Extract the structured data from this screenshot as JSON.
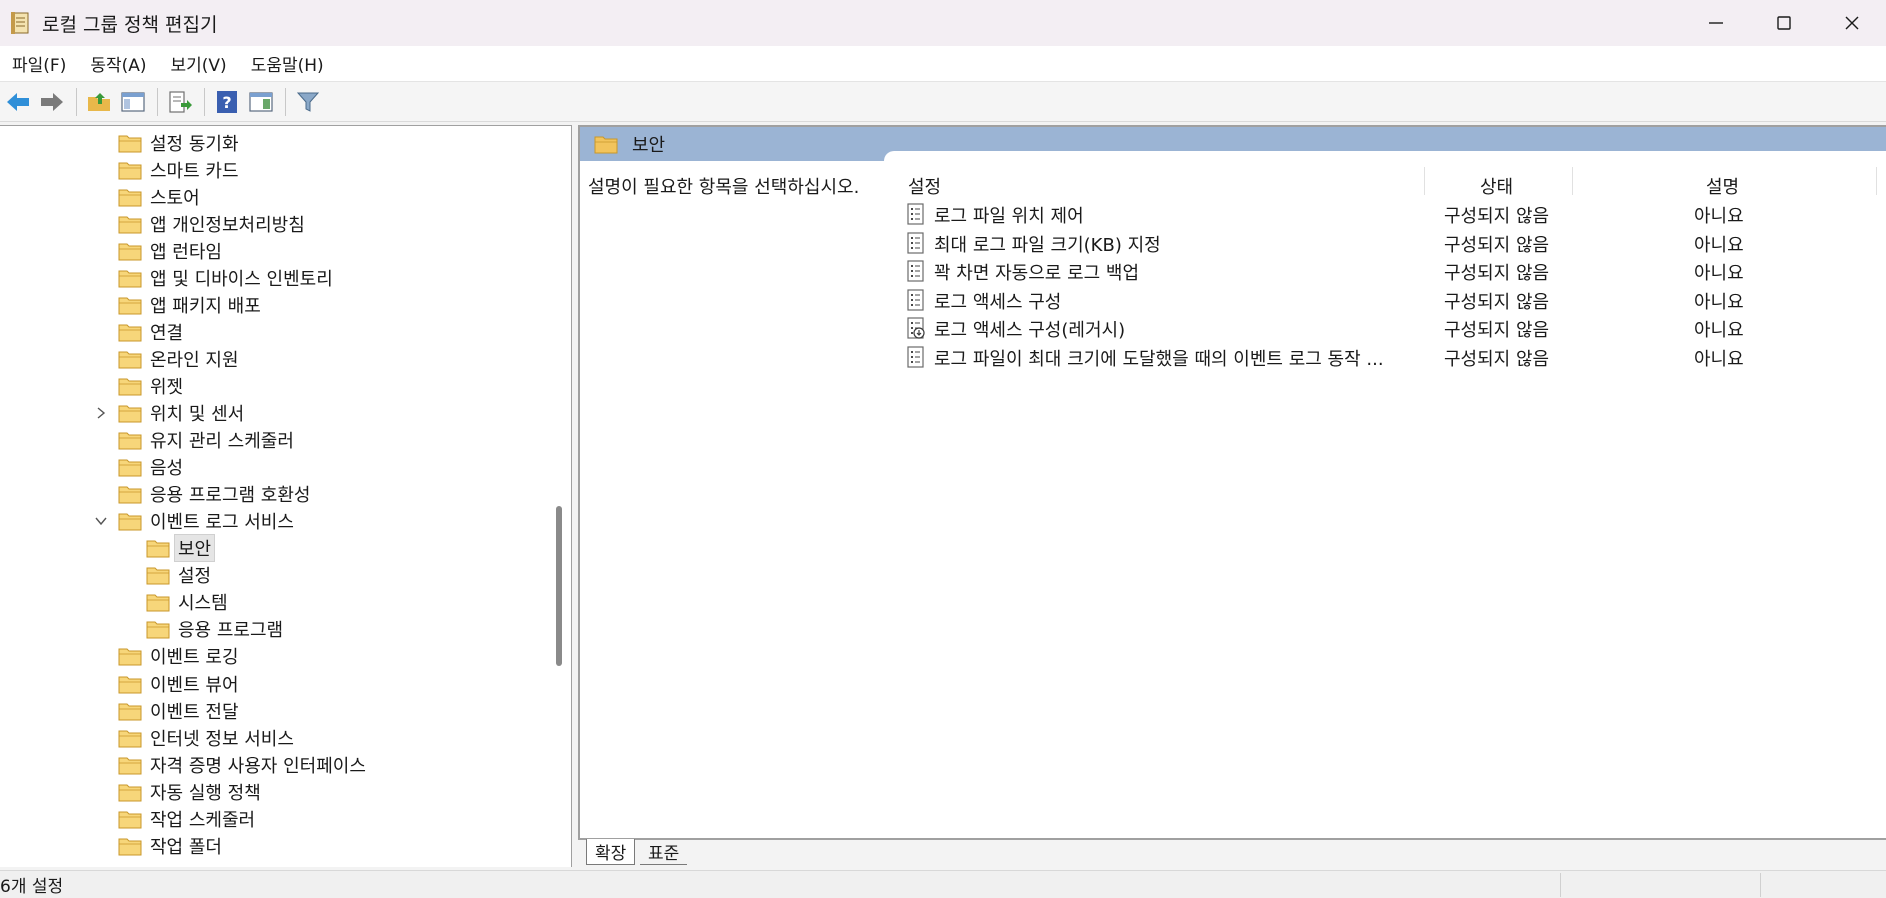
{
  "window": {
    "title": "로컬 그룹 정책 편집기",
    "minimize": "minimize-icon",
    "maximize": "maximize-icon",
    "close": "close-icon"
  },
  "menu": [
    "파일(F)",
    "동작(A)",
    "보기(V)",
    "도움말(H)"
  ],
  "toolbar": [
    "back-arrow-icon",
    "forward-arrow-icon",
    "up-folder-icon",
    "show-hide-tree-icon",
    "export-list-icon",
    "help-icon",
    "show-hide-action-pane-icon",
    "filter-icon"
  ],
  "tree": {
    "items": [
      {
        "label": "설정 동기화",
        "level": 1
      },
      {
        "label": "스마트 카드",
        "level": 1
      },
      {
        "label": "스토어",
        "level": 1
      },
      {
        "label": "앱 개인정보처리방침",
        "level": 1
      },
      {
        "label": "앱 런타임",
        "level": 1
      },
      {
        "label": "앱 및 디바이스 인벤토리",
        "level": 1
      },
      {
        "label": "앱 패키지 배포",
        "level": 1
      },
      {
        "label": "연결",
        "level": 1
      },
      {
        "label": "온라인 지원",
        "level": 1
      },
      {
        "label": "위젯",
        "level": 1
      },
      {
        "label": "위치 및 센서",
        "level": 1,
        "expander": "collapsed"
      },
      {
        "label": "유지 관리 스케줄러",
        "level": 1
      },
      {
        "label": "음성",
        "level": 1
      },
      {
        "label": "응용 프로그램 호환성",
        "level": 1
      },
      {
        "label": "이벤트 로그 서비스",
        "level": 1,
        "expander": "expanded"
      },
      {
        "label": "보안",
        "level": 2,
        "selected": true
      },
      {
        "label": "설정",
        "level": 2
      },
      {
        "label": "시스템",
        "level": 2
      },
      {
        "label": "응용 프로그램",
        "level": 2
      },
      {
        "label": "이벤트 로깅",
        "level": 1
      },
      {
        "label": "이벤트 뷰어",
        "level": 1
      },
      {
        "label": "이벤트 전달",
        "level": 1
      },
      {
        "label": "인터넷 정보 서비스",
        "level": 1
      },
      {
        "label": "자격 증명 사용자 인터페이스",
        "level": 1
      },
      {
        "label": "자동 실행 정책",
        "level": 1
      },
      {
        "label": "작업 스케줄러",
        "level": 1
      },
      {
        "label": "작업 폴더",
        "level": 1
      }
    ]
  },
  "right": {
    "header_title": "보안",
    "description_hint": "설명이 필요한 항목을 선택하십시오.",
    "columns": {
      "setting": "설정",
      "state": "상태",
      "comment": "설명"
    },
    "rows": [
      {
        "setting": "로그 파일 위치 제어",
        "state": "구성되지 않음",
        "comment": "아니요",
        "icon": "policy-setting-icon"
      },
      {
        "setting": "최대 로그 파일 크기(KB) 지정",
        "state": "구성되지 않음",
        "comment": "아니요",
        "icon": "policy-setting-icon"
      },
      {
        "setting": "꽉 차면 자동으로 로그 백업",
        "state": "구성되지 않음",
        "comment": "아니요",
        "icon": "policy-setting-icon"
      },
      {
        "setting": "로그 액세스 구성",
        "state": "구성되지 않음",
        "comment": "아니요",
        "icon": "policy-setting-icon"
      },
      {
        "setting": "로그 액세스 구성(레거시)",
        "state": "구성되지 않음",
        "comment": "아니요",
        "icon": "policy-setting-legacy-icon"
      },
      {
        "setting": "로그 파일이 최대 크기에 도달했을 때의 이벤트 로그 동작 ...",
        "state": "구성되지 않음",
        "comment": "아니요",
        "icon": "policy-setting-icon"
      }
    ]
  },
  "tabs": {
    "extended": "확장",
    "standard": "표준"
  },
  "status": {
    "text": "6개 설정"
  },
  "colors": {
    "header_bg": "#9bb4d4",
    "folder": "#f2c45c"
  }
}
